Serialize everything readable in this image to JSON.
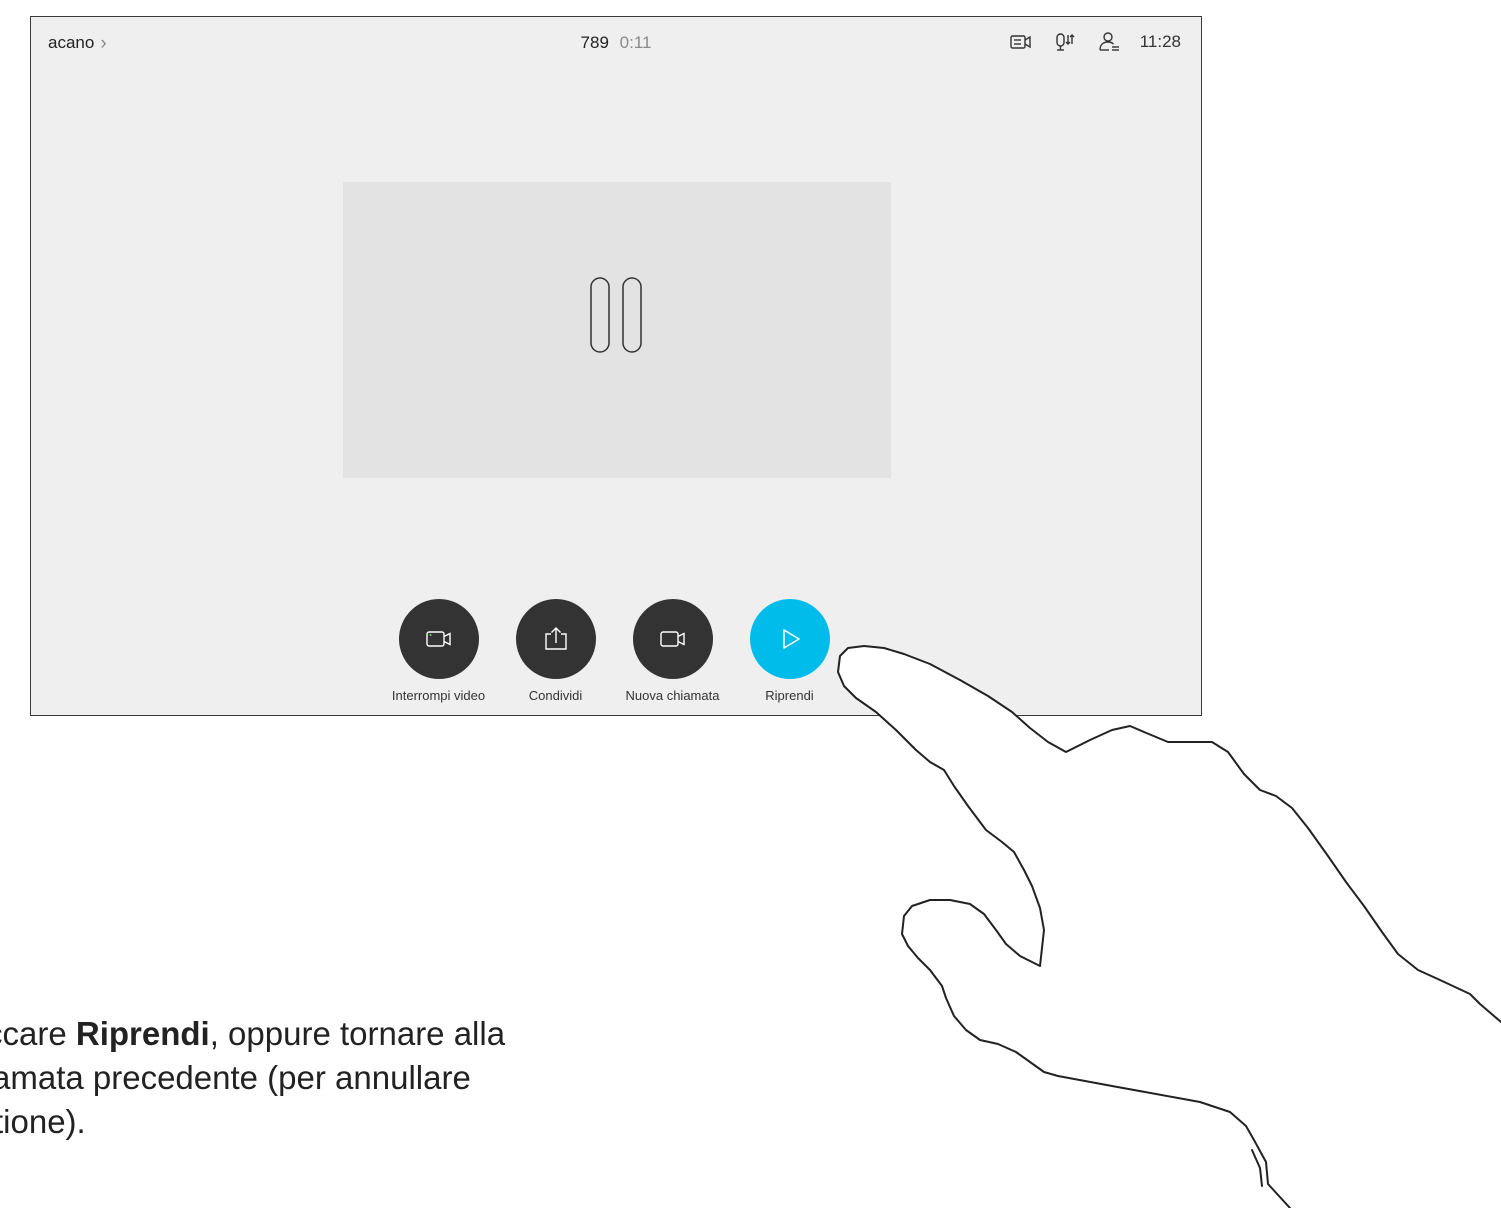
{
  "header": {
    "breadcrumb_label": "acano",
    "call_number": "789",
    "call_duration": "0:11",
    "clock": "11:28",
    "status_icons": [
      "presentation-icon",
      "microphone-icon",
      "participants-icon"
    ]
  },
  "preview": {
    "icon": "pause-icon",
    "background_color": "#e3e3e3"
  },
  "controls": [
    {
      "label": "Interrompi video",
      "icon": "stop-video-camera-icon"
    },
    {
      "label": "Condividi",
      "icon": "share-icon"
    },
    {
      "label": "Nuova chiamata",
      "icon": "video-camera-icon"
    },
    {
      "label": "Riprendi",
      "icon": "play-icon"
    }
  ],
  "colors": {
    "screen_background": "#efefef",
    "button_dark": "#333333",
    "button_accent": "#00bceb",
    "muted_text": "#8a8a8a"
  },
  "caption": {
    "line1_prefix": "ccare ",
    "line1_bold": "Riprendi",
    "line1_suffix": ", oppure tornare alla",
    "line2": "amata precedente (per annullare",
    "line3": "tione)."
  }
}
